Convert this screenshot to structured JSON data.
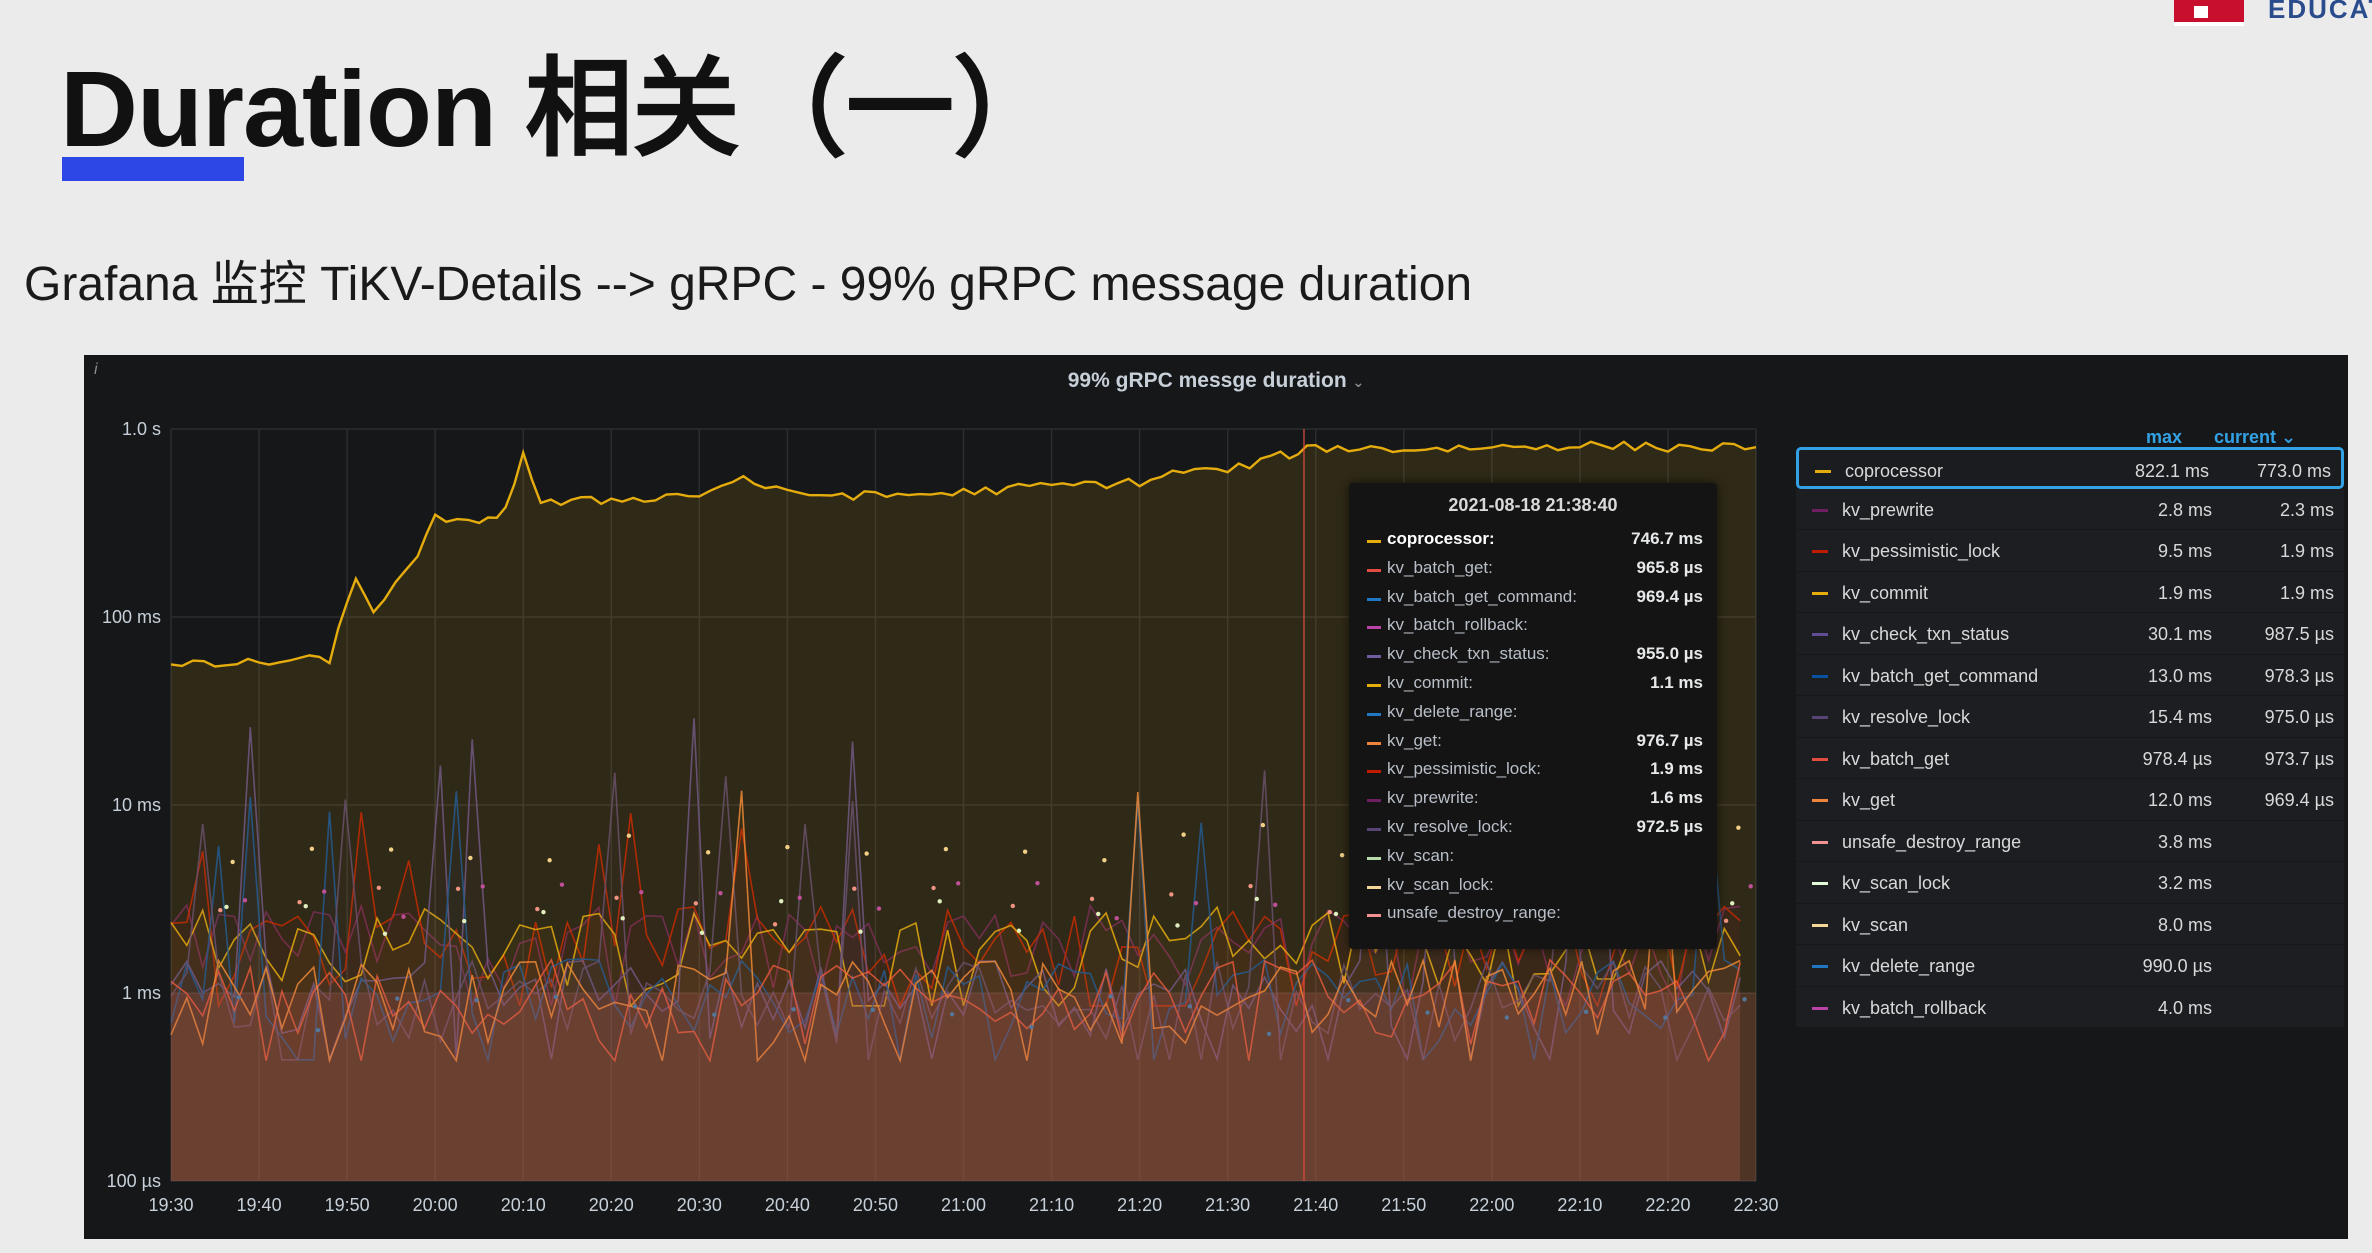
{
  "header": {
    "title": "Duration 相关（一）",
    "subtitle": "Grafana 监控 TiKV-Details -->  gRPC - 99% gRPC message duration",
    "logo_text": "EDUCAT"
  },
  "panel": {
    "info_icon": "i",
    "title": "99% gRPC messge duration",
    "title_chevron": "⌄"
  },
  "legend": {
    "max_label": "max",
    "current_label": "current ⌄",
    "items": [
      {
        "name": "coprocessor",
        "max": "822.1 ms",
        "current": "773.0 ms",
        "color": "#e5ac0e",
        "highlighted": true
      },
      {
        "name": "kv_prewrite",
        "max": "2.8 ms",
        "current": "2.3 ms",
        "color": "#6d1f62"
      },
      {
        "name": "kv_pessimistic_lock",
        "max": "9.5 ms",
        "current": "1.9 ms",
        "color": "#bf1b00"
      },
      {
        "name": "kv_commit",
        "max": "1.9 ms",
        "current": "1.9 ms",
        "color": "#e5ac0e"
      },
      {
        "name": "kv_check_txn_status",
        "max": "30.1 ms",
        "current": "987.5 µs",
        "color": "#614d93"
      },
      {
        "name": "kv_batch_get_command",
        "max": "13.0 ms",
        "current": "978.3 µs",
        "color": "#0a50a1"
      },
      {
        "name": "kv_resolve_lock",
        "max": "15.4 ms",
        "current": "975.0 µs",
        "color": "#584477"
      },
      {
        "name": "kv_batch_get",
        "max": "978.4 µs",
        "current": "973.7 µs",
        "color": "#e24d42"
      },
      {
        "name": "kv_get",
        "max": "12.0 ms",
        "current": "969.4 µs",
        "color": "#ef843c"
      },
      {
        "name": "unsafe_destroy_range",
        "max": "3.8 ms",
        "current": "",
        "color": "#f29191"
      },
      {
        "name": "kv_scan_lock",
        "max": "3.2 ms",
        "current": "",
        "color": "#e0f9d7"
      },
      {
        "name": "kv_scan",
        "max": "8.0 ms",
        "current": "",
        "color": "#f4d598"
      },
      {
        "name": "kv_delete_range",
        "max": "990.0 µs",
        "current": "",
        "color": "#1f78c1"
      },
      {
        "name": "kv_batch_rollback",
        "max": "4.0 ms",
        "current": "",
        "color": "#ba43a9"
      }
    ]
  },
  "tooltip": {
    "time": "2021-08-18 21:38:40",
    "rows": [
      {
        "label": "coprocessor:",
        "value": "746.7 ms",
        "color": "#e5ac0e",
        "bold": true
      },
      {
        "label": "kv_batch_get:",
        "value": "965.8 µs",
        "color": "#e24d42"
      },
      {
        "label": "kv_batch_get_command:",
        "value": "969.4 µs",
        "color": "#1f78c1"
      },
      {
        "label": "kv_batch_rollback:",
        "value": "",
        "color": "#ba43a9"
      },
      {
        "label": "kv_check_txn_status:",
        "value": "955.0 µs",
        "color": "#705da0"
      },
      {
        "label": "kv_commit:",
        "value": "1.1 ms",
        "color": "#e5ac0e"
      },
      {
        "label": "kv_delete_range:",
        "value": "",
        "color": "#1f78c1"
      },
      {
        "label": "kv_get:",
        "value": "976.7 µs",
        "color": "#ef843c"
      },
      {
        "label": "kv_pessimistic_lock:",
        "value": "1.9 ms",
        "color": "#bf1b00"
      },
      {
        "label": "kv_prewrite:",
        "value": "1.6 ms",
        "color": "#6d1f62"
      },
      {
        "label": "kv_resolve_lock:",
        "value": "972.5 µs",
        "color": "#584477"
      },
      {
        "label": "kv_scan:",
        "value": "",
        "color": "#b7dbab"
      },
      {
        "label": "kv_scan_lock:",
        "value": "",
        "color": "#f4d598"
      },
      {
        "label": "unsafe_destroy_range:",
        "value": "",
        "color": "#f29191"
      }
    ]
  },
  "chart_data": {
    "type": "line",
    "title": "99% gRPC messge duration",
    "y_scale": "log",
    "ylim_seconds": [
      0.0001,
      1.0
    ],
    "y_ticks": [
      {
        "label": "1.0 s",
        "value": 1.0
      },
      {
        "label": "100 ms",
        "value": 0.1
      },
      {
        "label": "10 ms",
        "value": 0.01
      },
      {
        "label": "1 ms",
        "value": 0.001
      },
      {
        "label": "100 µs",
        "value": 0.0001
      }
    ],
    "x_ticks": [
      "19:30",
      "19:40",
      "19:50",
      "20:00",
      "20:10",
      "20:20",
      "20:30",
      "20:40",
      "20:50",
      "21:00",
      "21:10",
      "21:20",
      "21:30",
      "21:40",
      "21:50",
      "22:00",
      "22:10",
      "22:20",
      "22:30"
    ],
    "x_range": [
      "19:30",
      "22:30"
    ],
    "grid": true,
    "cursor_time": "21:38:40",
    "series": [
      {
        "name": "coprocessor",
        "color": "#e5ac0e",
        "x": [
          "19:30",
          "19:40",
          "19:48",
          "19:51",
          "19:53",
          "19:58",
          "20:00",
          "20:05",
          "20:08",
          "20:10",
          "20:12",
          "20:20",
          "20:30",
          "20:35",
          "20:40",
          "20:45",
          "20:50",
          "21:00",
          "21:10",
          "21:20",
          "21:25",
          "21:30",
          "21:35",
          "21:38",
          "21:40",
          "21:50",
          "22:00",
          "22:10",
          "22:20",
          "22:30"
        ],
        "y": [
          0.055,
          0.057,
          0.06,
          0.16,
          0.11,
          0.2,
          0.35,
          0.3,
          0.38,
          0.75,
          0.4,
          0.42,
          0.45,
          0.55,
          0.45,
          0.45,
          0.44,
          0.46,
          0.5,
          0.52,
          0.6,
          0.6,
          0.7,
          0.75,
          0.8,
          0.78,
          0.8,
          0.82,
          0.8,
          0.8
        ]
      },
      {
        "name": "kv_prewrite",
        "color": "#6d1f62",
        "typical": 0.0019,
        "max": 0.0028
      },
      {
        "name": "kv_pessimistic_lock",
        "color": "#bf1b00",
        "typical": 0.0019,
        "max": 0.0095
      },
      {
        "name": "kv_commit",
        "color": "#e5ac0e",
        "typical": 0.0019,
        "max": 0.0019
      },
      {
        "name": "kv_check_txn_status",
        "color": "#614d93",
        "typical": 0.00099,
        "max": 0.0301
      },
      {
        "name": "kv_batch_get_command",
        "color": "#0a50a1",
        "typical": 0.00098,
        "max": 0.013
      },
      {
        "name": "kv_resolve_lock",
        "color": "#584477",
        "typical": 0.00098,
        "max": 0.0154
      },
      {
        "name": "kv_batch_get",
        "color": "#e24d42",
        "typical": 0.00097,
        "max": 0.00098
      },
      {
        "name": "kv_get",
        "color": "#ef843c",
        "typical": 0.00097,
        "max": 0.012
      },
      {
        "name": "unsafe_destroy_range",
        "color": "#f29191",
        "max": 0.0038
      },
      {
        "name": "kv_scan_lock",
        "color": "#e0f9d7",
        "max": 0.0032
      },
      {
        "name": "kv_scan",
        "color": "#f4d598",
        "max": 0.008
      },
      {
        "name": "kv_delete_range",
        "color": "#1f78c1",
        "max": 0.00099
      },
      {
        "name": "kv_batch_rollback",
        "color": "#ba43a9",
        "max": 0.004
      }
    ]
  }
}
